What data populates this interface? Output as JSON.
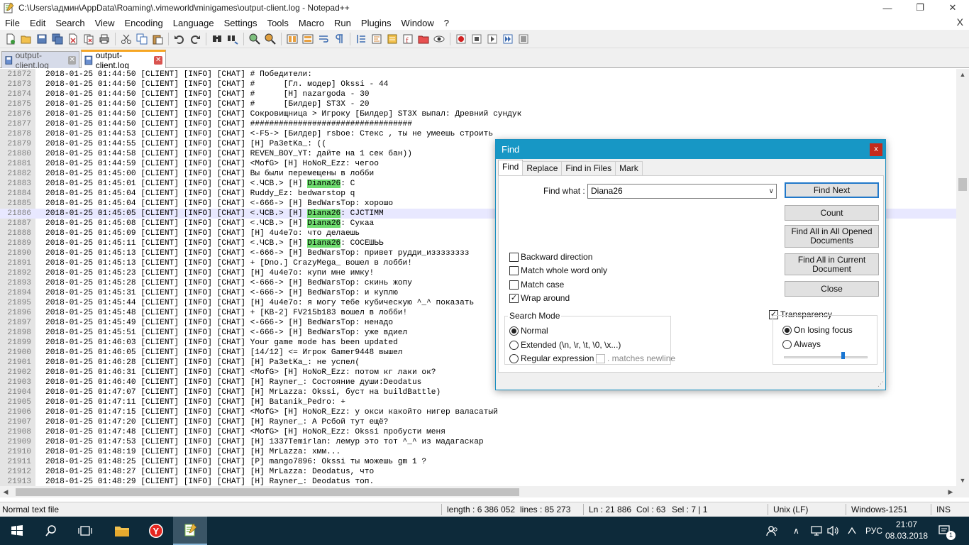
{
  "window": {
    "title": "C:\\Users\\админ\\AppData\\Roaming\\.vimeworld\\minigames\\output-client.log - Notepad++",
    "menu_close": "X"
  },
  "menu": [
    "File",
    "Edit",
    "Search",
    "View",
    "Encoding",
    "Language",
    "Settings",
    "Tools",
    "Macro",
    "Run",
    "Plugins",
    "Window",
    "?"
  ],
  "tabs": [
    {
      "label": "output-client.log",
      "active": false
    },
    {
      "label": "output-client.log",
      "active": true
    }
  ],
  "editor": {
    "lines": [
      {
        "n": "21872",
        "t": "2018-01-25 01:44:50 [CLIENT] [INFO] [CHAT] # Победители:"
      },
      {
        "n": "21873",
        "t": "2018-01-25 01:44:50 [CLIENT] [INFO] [CHAT] #      [Гл. модер] Okssi - 44"
      },
      {
        "n": "21874",
        "t": "2018-01-25 01:44:50 [CLIENT] [INFO] [CHAT] #      [H] nazargoda - 30"
      },
      {
        "n": "21875",
        "t": "2018-01-25 01:44:50 [CLIENT] [INFO] [CHAT] #      [Билдер] ST3X - 20"
      },
      {
        "n": "21876",
        "t": "2018-01-25 01:44:50 [CLIENT] [INFO] [CHAT] Сокровищница > Игроку [Билдер] ST3X выпал: Древний сундук"
      },
      {
        "n": "21877",
        "t": "2018-01-25 01:44:50 [CLIENT] [INFO] [CHAT] ##################################"
      },
      {
        "n": "21878",
        "t": "2018-01-25 01:44:53 [CLIENT] [INFO] [CHAT] <-F5-> [Билдер] rsboe: Стекс , ты не умеешь строить"
      },
      {
        "n": "21879",
        "t": "2018-01-25 01:44:55 [CLIENT] [INFO] [CHAT] [H] Pa3etKa_: (("
      },
      {
        "n": "21880",
        "t": "2018-01-25 01:44:58 [CLIENT] [INFO] [CHAT] REVEN_BOY_YT: дайте на 1 сек бан))"
      },
      {
        "n": "21881",
        "t": "2018-01-25 01:44:59 [CLIENT] [INFO] [CHAT] <MofG> [H] HoNoR_Ezz: чегоо"
      },
      {
        "n": "21882",
        "t": "2018-01-25 01:45:00 [CLIENT] [INFO] [CHAT] Вы были перемещены в лобби"
      },
      {
        "n": "21883",
        "t": "2018-01-25 01:45:01 [CLIENT] [INFO] [CHAT] <.ЧСВ.> [H] ",
        "hl": "Diana26",
        "after": ": С"
      },
      {
        "n": "21884",
        "t": "2018-01-25 01:45:04 [CLIENT] [INFO] [CHAT] Ruddy_Ez: bedwarstop q"
      },
      {
        "n": "21885",
        "t": "2018-01-25 01:45:04 [CLIENT] [INFO] [CHAT] <-666-> [H] BedWarsTop: хорошо"
      },
      {
        "n": "21886",
        "t": "2018-01-25 01:45:05 [CLIENT] [INFO] [CHAT] <.ЧСВ.> [H] ",
        "hl": "Diana26",
        "after": ": СJCTIMM",
        "current": true
      },
      {
        "n": "21887",
        "t": "2018-01-25 01:45:08 [CLIENT] [INFO] [CHAT] <.ЧСВ.> [H] ",
        "hl": "Diana26",
        "after": ": Сукаа"
      },
      {
        "n": "21888",
        "t": "2018-01-25 01:45:09 [CLIENT] [INFO] [CHAT] [H] 4u4e7o: что делаешь"
      },
      {
        "n": "21889",
        "t": "2018-01-25 01:45:11 [CLIENT] [INFO] [CHAT] <.ЧСВ.> [H] ",
        "hl": "Diana26",
        "after": ": СОСЕШЬЬ"
      },
      {
        "n": "21890",
        "t": "2018-01-25 01:45:13 [CLIENT] [INFO] [CHAT] <-666-> [H] BedWarsTop: привет рудди_изззззззз"
      },
      {
        "n": "21891",
        "t": "2018-01-25 01:45:13 [CLIENT] [INFO] [CHAT] + [Dno.] CrazyMega_ вошел в лобби!"
      },
      {
        "n": "21892",
        "t": "2018-01-25 01:45:23 [CLIENT] [INFO] [CHAT] [H] 4u4e7o: купи мне имку!"
      },
      {
        "n": "21893",
        "t": "2018-01-25 01:45:28 [CLIENT] [INFO] [CHAT] <-666-> [H] BedWarsTop: скинь жопу"
      },
      {
        "n": "21894",
        "t": "2018-01-25 01:45:31 [CLIENT] [INFO] [CHAT] <-666-> [H] BedWarsTop: и куплю"
      },
      {
        "n": "21895",
        "t": "2018-01-25 01:45:44 [CLIENT] [INFO] [CHAT] [H] 4u4e7o: я могу тебе кубическую ^_^ показать"
      },
      {
        "n": "21896",
        "t": "2018-01-25 01:45:48 [CLIENT] [INFO] [CHAT] + [KB-2] FV215b183 вошел в лобби!"
      },
      {
        "n": "21897",
        "t": "2018-01-25 01:45:49 [CLIENT] [INFO] [CHAT] <-666-> [H] BedWarsTop: ненадо"
      },
      {
        "n": "21898",
        "t": "2018-01-25 01:45:51 [CLIENT] [INFO] [CHAT] <-666-> [H] BedWarsTop: уже вдиел"
      },
      {
        "n": "21899",
        "t": "2018-01-25 01:46:03 [CLIENT] [INFO] [CHAT] Your game mode has been updated"
      },
      {
        "n": "21900",
        "t": "2018-01-25 01:46:05 [CLIENT] [INFO] [CHAT] [14/12] <= Игрок Gamer9448 вышел"
      },
      {
        "n": "21901",
        "t": "2018-01-25 01:46:28 [CLIENT] [INFO] [CHAT] [H] Pa3etKa_: не успел("
      },
      {
        "n": "21902",
        "t": "2018-01-25 01:46:31 [CLIENT] [INFO] [CHAT] <MofG> [H] HoNoR_Ezz: потом кг лаки ок?"
      },
      {
        "n": "21903",
        "t": "2018-01-25 01:46:40 [CLIENT] [INFO] [CHAT] [H] Rayner_: Состояние души:Deodatus"
      },
      {
        "n": "21904",
        "t": "2018-01-25 01:47:07 [CLIENT] [INFO] [CHAT] [H] MrLazza: Okssi, буст на buildBattle)"
      },
      {
        "n": "21905",
        "t": "2018-01-25 01:47:11 [CLIENT] [INFO] [CHAT] [H] Batanik_Pedro: +"
      },
      {
        "n": "21906",
        "t": "2018-01-25 01:47:15 [CLIENT] [INFO] [CHAT] <MofG> [H] HoNoR_Ezz: у окси какойто нигер валасатый"
      },
      {
        "n": "21907",
        "t": "2018-01-25 01:47:20 [CLIENT] [INFO] [CHAT] [H] Rayner_: А Рсбой тут ещё?"
      },
      {
        "n": "21908",
        "t": "2018-01-25 01:47:48 [CLIENT] [INFO] [CHAT] <MofG> [H] HoNoR_Ezz: Okssi пробусти меня"
      },
      {
        "n": "21909",
        "t": "2018-01-25 01:47:53 [CLIENT] [INFO] [CHAT] [H] 1337Temirlan: лемур это тот ^_^ из мадагаскар"
      },
      {
        "n": "21910",
        "t": "2018-01-25 01:48:19 [CLIENT] [INFO] [CHAT] [H] MrLazza: хмм..."
      },
      {
        "n": "21911",
        "t": "2018-01-25 01:48:25 [CLIENT] [INFO] [CHAT] [P] mango7896: Okssi ты можешь gm 1 ?"
      },
      {
        "n": "21912",
        "t": "2018-01-25 01:48:27 [CLIENT] [INFO] [CHAT] [H] MrLazza: Deodatus, что"
      },
      {
        "n": "21913",
        "t": "2018-01-25 01:48:29 [CLIENT] [INFO] [CHAT] [H] Rayner_: Deodatus топ."
      }
    ]
  },
  "status": {
    "file_type": "Normal text file",
    "length": "length : 6 386 052",
    "lines": "lines : 85 273",
    "ln": "Ln : 21 886",
    "col": "Col : 63",
    "sel": "Sel : 7 | 1",
    "eol": "Unix (LF)",
    "encoding": "Windows-1251",
    "mode": "INS"
  },
  "find_dialog": {
    "title": "Find",
    "close": "x",
    "tabs": [
      "Find",
      "Replace",
      "Find in Files",
      "Mark"
    ],
    "find_what_label": "Find what :",
    "find_what_value": "Diana26",
    "buttons": {
      "find_next": "Find Next",
      "count": "Count",
      "find_all_opened": "Find All in All Opened Documents",
      "find_all_current": "Find All in Current Document",
      "close": "Close"
    },
    "options": {
      "backward": {
        "label": "Backward direction",
        "checked": false
      },
      "whole_word": {
        "label": "Match whole word only",
        "checked": false
      },
      "match_case": {
        "label": "Match case",
        "checked": false
      },
      "wrap_around": {
        "label": "Wrap around",
        "checked": true
      }
    },
    "search_mode": {
      "title": "Search Mode",
      "normal": "Normal",
      "extended": "Extended (\\n, \\r, \\t, \\0, \\x...)",
      "regex": "Regular expression",
      "matches_newline": ". matches newline",
      "selected": "normal"
    },
    "transparency": {
      "label": "Transparency",
      "checked": true,
      "on_losing_focus": "On losing focus",
      "always": "Always",
      "selected": "on_losing_focus",
      "level": 0.7
    }
  },
  "taskbar": {
    "language": "РУС",
    "time": "21:07",
    "date": "08.03.2018",
    "notifications": "1"
  },
  "colors": {
    "dialog_title": "#1797c5",
    "search_highlight": "#6fdc6f",
    "current_line": "#e8e8ff",
    "tab_accent": "#f6a623"
  }
}
